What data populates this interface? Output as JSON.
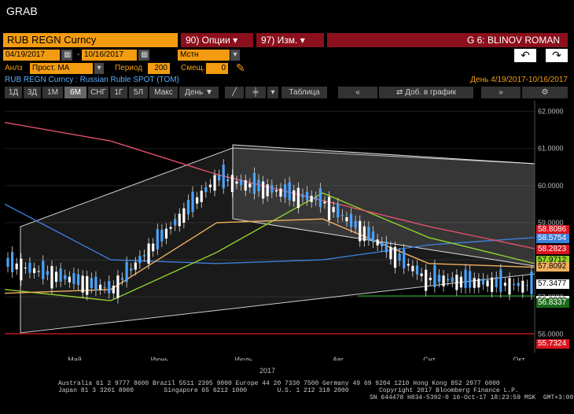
{
  "app_title": "GRAB",
  "ticker": "RUB REGN Curncy",
  "menu": {
    "options": "90) Опции",
    "edit": "97) Изм.",
    "group": "G 6: BLINOV ROMAN"
  },
  "controls": {
    "date_from": "04/19/2017",
    "date_to": "10/16/2017",
    "currency": "Мстн валюта",
    "anly_label": "Анлз",
    "anly_value": "Прост. MA",
    "period_label": "Период",
    "period_value": "200",
    "shift_label": "Смещ.",
    "shift_value": "0"
  },
  "subtitle": "RUB REGN Curncy : Russian Ruble SPOT (TOM)",
  "range_text": "День  4/19/2017-10/16/2017",
  "tabs": [
    "1Д",
    "3Д",
    "1М",
    "6М",
    "СНГ",
    "1Г",
    "5Л",
    "Макс",
    "День ▼",
    "Таблица",
    "Доб. в график"
  ],
  "active_tab": "6М",
  "colors": {
    "orange": "#f39c12",
    "menu_bg": "#8b0f1c",
    "ma_red": "#e0506a",
    "ma_blue": "#3b7fd9",
    "ma_green": "#8fd12c",
    "ma_yellow": "#f0b060",
    "candle": "#4aa3ff"
  },
  "y_axis": [
    "62.0000",
    "61.0000",
    "60.0000",
    "59.0000",
    "58.0000",
    "57.0000",
    "56.0000"
  ],
  "x_axis": [
    "Май",
    "Июнь",
    "Июль",
    "Авг",
    "Снт",
    "Окт"
  ],
  "year_label": "2017",
  "price_tags": [
    {
      "value": "58.8086",
      "color": "#d9151f",
      "text_color": "#fff"
    },
    {
      "value": "58.5754",
      "color": "#3b7fd9",
      "text_color": "#fff"
    },
    {
      "value": "58.2823",
      "color": "#d9151f",
      "text_color": "#fff"
    },
    {
      "value": "57.9712",
      "color": "#8fd12c",
      "text_color": "#000"
    },
    {
      "value": "57.8092",
      "color": "#f0b060",
      "text_color": "#000"
    },
    {
      "value": "57.3477",
      "color": "#fff",
      "text_color": "#000"
    },
    {
      "value": "56.9033",
      "color": "#fff",
      "text_color": "#000"
    },
    {
      "value": "56.8337",
      "color": "#1a6b1a",
      "text_color": "#fff"
    },
    {
      "value": "55.7324",
      "color": "#d9151f",
      "text_color": "#fff"
    }
  ],
  "chart_data": {
    "type": "line",
    "ylim": [
      55.5,
      62.2
    ],
    "x": [
      "Май",
      "Июнь",
      "Июль",
      "Авг",
      "Снт",
      "Окт"
    ],
    "series": [
      {
        "values": [
          57.9,
          57.2,
          60.2,
          59.6,
          57.5,
          57.3
        ]
      },
      {
        "values": [
          59.5,
          58.0,
          57.9,
          58.0,
          58.4,
          58.6
        ]
      },
      {
        "values": [
          57.2,
          56.9,
          58.2,
          59.8,
          58.6,
          57.9
        ]
      },
      {
        "values": [
          57.1,
          57.2,
          59.0,
          59.1,
          57.9,
          57.8
        ]
      },
      {
        "values": [
          61.7,
          61.2,
          60.3,
          59.6,
          58.9,
          58.3
        ]
      }
    ]
  },
  "footer": {
    "line1": "Australia 61 2 9777 8600 Brazil 5511 2395 9000 Europe 44 20 7330 7500 Germany 49 69 9204 1210 Hong Kong 852 2977 6000",
    "line2": "Japan 81 3 3201 8900        Singapore 65 6212 1000        U.S. 1 212 318 2000        Copyright 2017 Bloomberg Finance L.P.",
    "line3": "SN 644478 H834-5392-0 16-Oct-17 18:23:59 MSK  GMT+3:00"
  }
}
